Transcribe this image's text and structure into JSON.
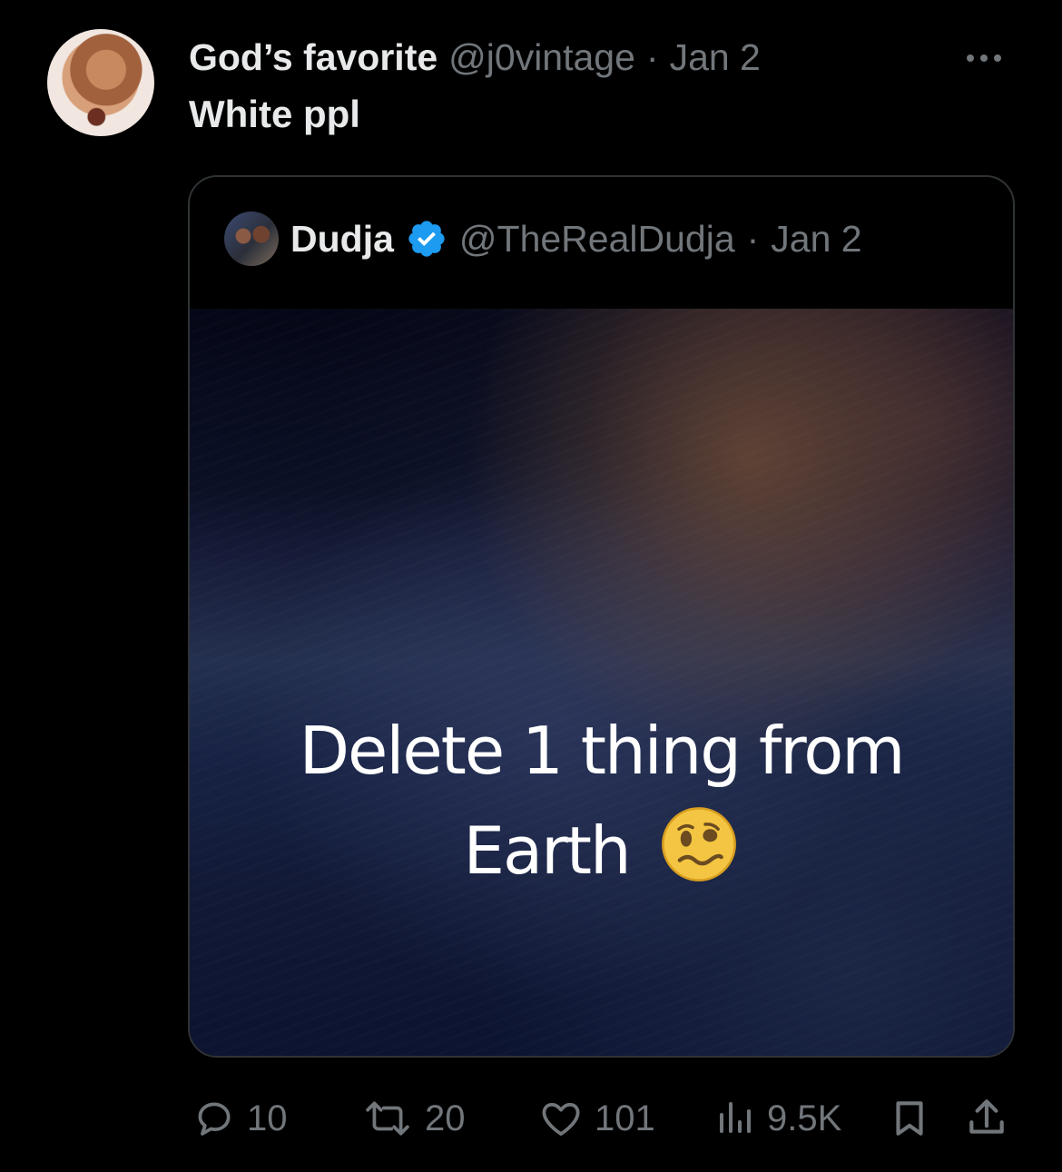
{
  "post": {
    "display_name": "God’s favorite",
    "handle": "@j0vintage",
    "separator": "·",
    "date": "Jan 2",
    "text": "White ppl",
    "more_icon": "ellipsis-icon"
  },
  "quoted_post": {
    "display_name": "Dudja",
    "verified": true,
    "verified_color": "#1d9bf0",
    "handle": "@TheRealDudja",
    "separator": "·",
    "date": "Jan 2",
    "media_text_line1": "Delete 1 thing from",
    "media_text_line2": "Earth",
    "media_emoji": "woozy-face-icon"
  },
  "actions": {
    "replies": "10",
    "reposts": "20",
    "likes": "101",
    "views": "9.5K",
    "bookmark_icon": "bookmark-icon",
    "share_icon": "share-icon"
  },
  "colors": {
    "background": "#000000",
    "primary_text": "#e7e9ea",
    "secondary_text": "#71767b",
    "border": "#2f3336"
  }
}
